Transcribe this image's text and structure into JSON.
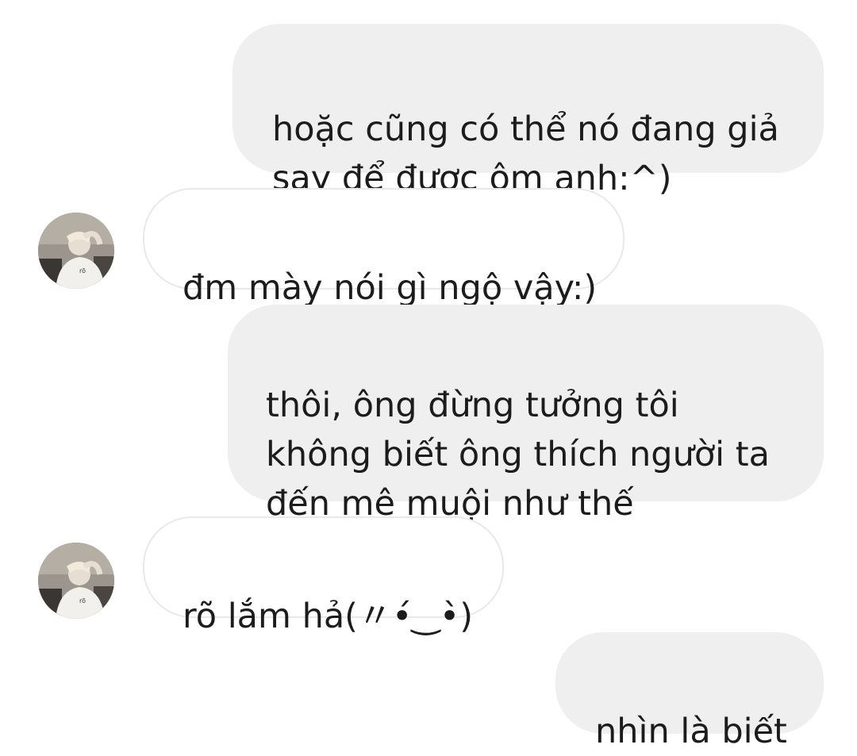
{
  "messages": [
    {
      "side": "outgoing",
      "text": "hoặc cũng có thể nó đang giả\nsay để được ôm anh:^)"
    },
    {
      "side": "incoming",
      "text": "đm mày nói gì ngộ vậy:)"
    },
    {
      "side": "outgoing",
      "text": "thôi, ông đừng tưởng tôi\nkhông biết ông thích người ta\nđến mê muội như thế"
    },
    {
      "side": "incoming",
      "text": "rõ lắm hả(〃•́‿•̀)"
    },
    {
      "side": "outgoing",
      "text": "nhìn là biết"
    }
  ],
  "colors": {
    "outgoing_bubble": "#efefef",
    "incoming_bubble": "#ffffff",
    "incoming_border": "#e9e9e9",
    "text": "#1c1c1c"
  },
  "avatar": {
    "icon": "profile-photo-avatar"
  }
}
